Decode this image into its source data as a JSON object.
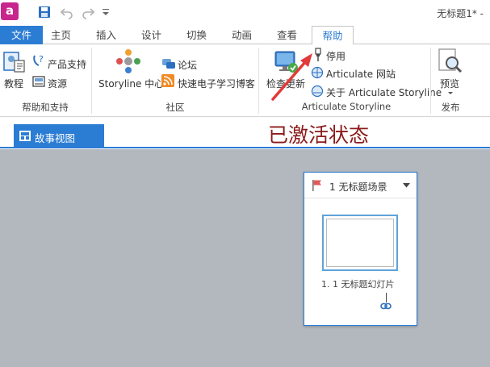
{
  "window": {
    "app_logo": "a",
    "title": "无标题1* -"
  },
  "tabs": [
    "文件",
    "主页",
    "插入",
    "设计",
    "切换",
    "动画",
    "查看",
    "帮助"
  ],
  "ribbon": {
    "help_group": {
      "tutorials": "教程",
      "product_support": "产品支持",
      "resources": "资源",
      "label": "帮助和支持"
    },
    "community_group": {
      "storyline_center": "Storyline 中心",
      "forums": "论坛",
      "blog": "快速电子学习博客",
      "label": "社区"
    },
    "articulate_group": {
      "check_updates": "检查更新",
      "deactivate": "停用",
      "website": "Articulate 网站",
      "about": "关于 Articulate Storyline",
      "label": "Articulate Storyline"
    },
    "publish_group": {
      "preview": "预览",
      "label": "发布"
    }
  },
  "view": {
    "story_view_tab": "故事视图",
    "activated_text": "已激活状态"
  },
  "scene": {
    "title": "1 无标题场景",
    "slide_label": "1. 1 无标题幻灯片"
  },
  "colors": {
    "accent": "#2b7cd3",
    "canvas": "#b3b8bf",
    "annotation": "#8b1a1a",
    "arrow": "#e23a3a"
  }
}
